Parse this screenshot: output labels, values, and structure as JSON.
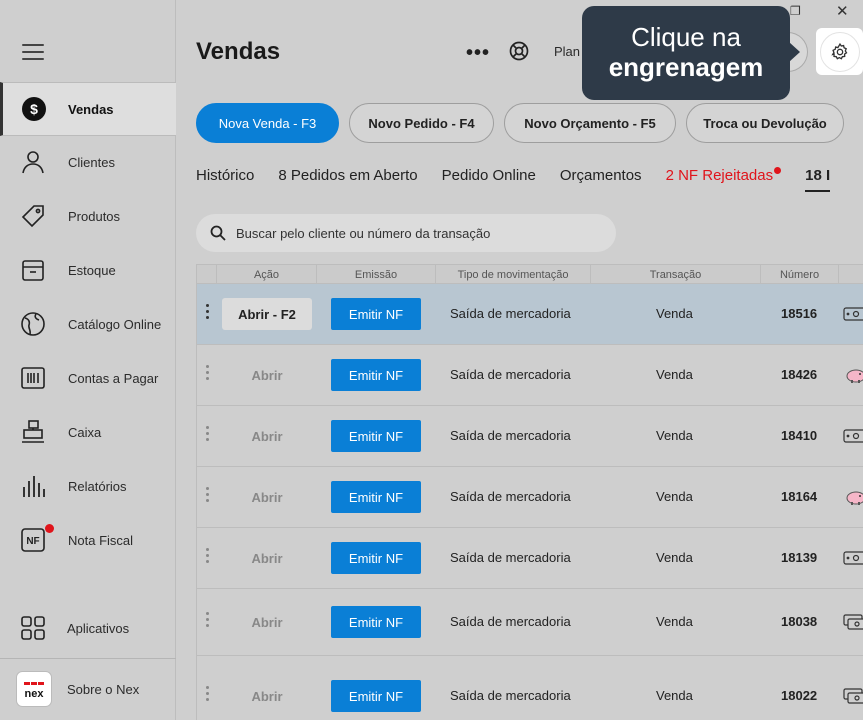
{
  "window": {
    "restore_icon": "restore-icon",
    "close_icon": "close-icon"
  },
  "sidebar": {
    "menu_icon": "hamburger-icon",
    "items": [
      {
        "label": "Vendas",
        "icon": "dollar-icon",
        "active": true
      },
      {
        "label": "Clientes",
        "icon": "user-icon"
      },
      {
        "label": "Produtos",
        "icon": "tag-icon"
      },
      {
        "label": "Estoque",
        "icon": "box-icon"
      },
      {
        "label": "Catálogo Online",
        "icon": "globe-icon"
      },
      {
        "label": "Contas a Pagar",
        "icon": "barcode-icon"
      },
      {
        "label": "Caixa",
        "icon": "register-icon"
      },
      {
        "label": "Relatórios",
        "icon": "bars-icon"
      },
      {
        "label": "Nota Fiscal",
        "icon": "nf-icon",
        "badge": true
      }
    ],
    "bottom": [
      {
        "label": "Aplicativos",
        "icon": "apps-icon"
      },
      {
        "label": "Sobre o Nex",
        "icon": "nex-logo-icon"
      }
    ],
    "nf_icon_text": "NF",
    "nex_logo_text": "nex"
  },
  "header": {
    "title": "Vendas",
    "more": "•••",
    "plan_label": "Plan",
    "settings_icon": "gear-icon"
  },
  "tooltip": {
    "line1": "Clique na",
    "line2": "engrenagem"
  },
  "actions": [
    {
      "label": "Nova Venda - F3",
      "primary": true
    },
    {
      "label": "Novo Pedido - F4"
    },
    {
      "label": "Novo Orçamento - F5"
    },
    {
      "label": "Troca ou Devolução"
    }
  ],
  "tabs": [
    {
      "label": "Histórico"
    },
    {
      "label": "8 Pedidos em Aberto"
    },
    {
      "label": "Pedido Online"
    },
    {
      "label": "Orçamentos"
    },
    {
      "label": "2 NF Rejeitadas",
      "alert": true
    },
    {
      "label": "18 I"
    }
  ],
  "search": {
    "placeholder": "Buscar pelo cliente ou número da transação"
  },
  "table": {
    "columns": [
      "Ação",
      "Emissão",
      "Tipo de movimentação",
      "Transação",
      "Número"
    ],
    "rows": [
      {
        "open": "Abrir - F2",
        "emit": "Emitir NF",
        "mov": "Saída de mercadoria",
        "trans": "Venda",
        "num": "18516",
        "pay": "cash",
        "selected": true
      },
      {
        "open": "Abrir",
        "emit": "Emitir NF",
        "mov": "Saída de mercadoria",
        "trans": "Venda",
        "num": "18426",
        "pay": "piggy"
      },
      {
        "open": "Abrir",
        "emit": "Emitir NF",
        "mov": "Saída de mercadoria",
        "trans": "Venda",
        "num": "18410",
        "pay": "cash"
      },
      {
        "open": "Abrir",
        "emit": "Emitir NF",
        "mov": "Saída de mercadoria",
        "trans": "Venda",
        "num": "18164",
        "pay": "piggy"
      },
      {
        "open": "Abrir",
        "emit": "Emitir NF",
        "mov": "Saída de mercadoria",
        "trans": "Venda",
        "num": "18139",
        "pay": "cash"
      },
      {
        "open": "Abrir",
        "emit": "Emitir NF",
        "mov": "Saída de mercadoria",
        "trans": "Venda",
        "num": "18038",
        "pay": "cash-stack"
      },
      {
        "open": "Abrir",
        "emit": "Emitir NF",
        "mov": "Saída de mercadoria",
        "trans": "Venda",
        "num": "18022",
        "pay": "cash-stack"
      }
    ]
  }
}
